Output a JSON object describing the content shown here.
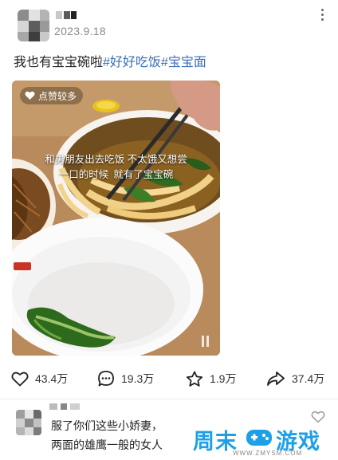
{
  "post": {
    "date": "2023.9.18",
    "text_plain": "我也有宝宝碗啦",
    "hashtags": [
      "#好好吃饭",
      "#宝宝面"
    ]
  },
  "photo": {
    "badge": "点赞较多",
    "caption_line1": "和男朋友出去吃饭 不太饿又想尝",
    "caption_line2a": "一口的时候",
    "caption_line2b": "就有了宝宝碗"
  },
  "actions": {
    "like_count": "43.4万",
    "comment_count": "19.3万",
    "favorite_count": "1.9万",
    "share_count": "37.4万"
  },
  "comment": {
    "line1": "服了你们这些小娇妻，",
    "line2": "两面的雄鹰一般的女人"
  },
  "watermark": {
    "part1": "周末",
    "part2": "游戏",
    "url": "WWW.ZMYSM.COM"
  },
  "colors": {
    "hashtag": "#3b6fb6",
    "watermark": "#1da0e8"
  },
  "icons": [
    "more-icon",
    "heart-icon",
    "comment-icon",
    "star-icon",
    "share-icon",
    "pause-icon"
  ]
}
